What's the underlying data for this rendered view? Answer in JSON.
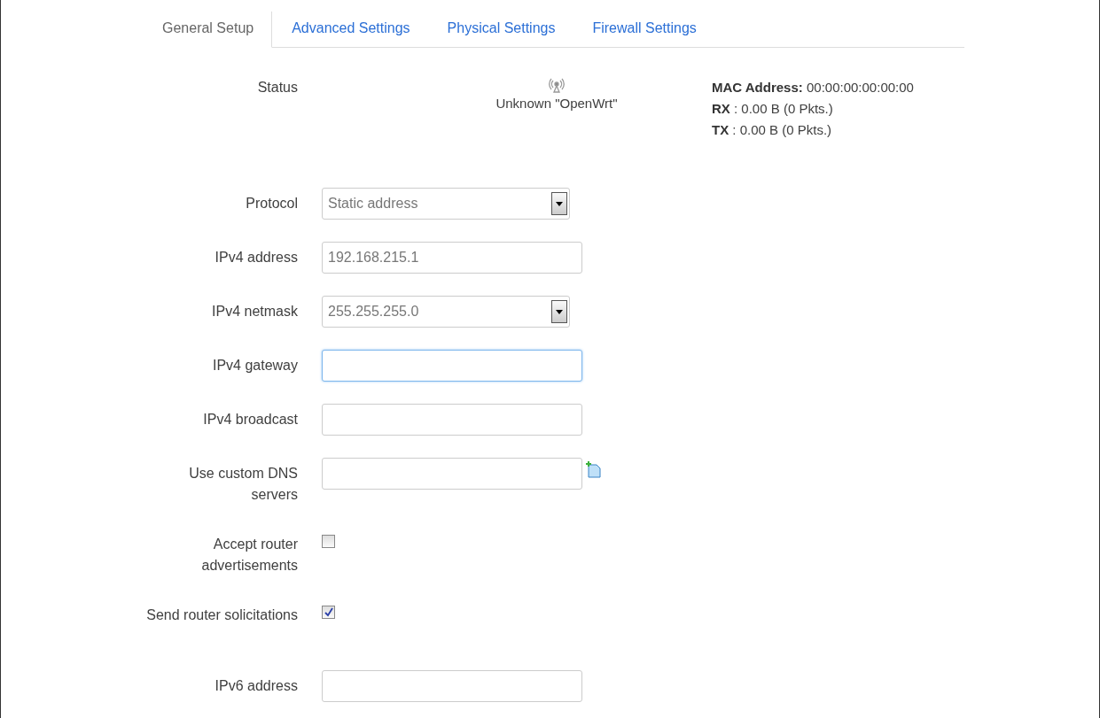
{
  "tabs": [
    {
      "label": "General Setup",
      "selected": true
    },
    {
      "label": "Advanced Settings",
      "selected": false
    },
    {
      "label": "Physical Settings",
      "selected": false
    },
    {
      "label": "Firewall Settings",
      "selected": false
    }
  ],
  "status": {
    "label": "Status",
    "device": "Unknown \"OpenWrt\"",
    "details": [
      {
        "key": "MAC Address:",
        "value": "00:00:00:00:00:00"
      },
      {
        "key": "RX",
        "value": ": 0.00 B (0 Pkts.)"
      },
      {
        "key": "TX",
        "value": ": 0.00 B (0 Pkts.)"
      }
    ]
  },
  "fields": [
    {
      "kind": "select",
      "label": "Protocol",
      "value": "Static address"
    },
    {
      "kind": "text",
      "label": "IPv4 address",
      "value": "192.168.215.1",
      "focused": false
    },
    {
      "kind": "select",
      "label": "IPv4 netmask",
      "value": "255.255.255.0"
    },
    {
      "kind": "text",
      "label": "IPv4 gateway",
      "focused": true
    },
    {
      "kind": "text",
      "label": "IPv4 broadcast",
      "focused": false
    },
    {
      "kind": "list",
      "label": "Use custom DNS servers",
      "focused": false
    },
    {
      "kind": "checkbox",
      "label": "Accept router advertisements",
      "checked": false
    },
    {
      "kind": "checkbox",
      "label": "Send router solicitations",
      "checked": true
    },
    {
      "kind": "text",
      "label": "IPv6 address",
      "focused": false
    }
  ]
}
